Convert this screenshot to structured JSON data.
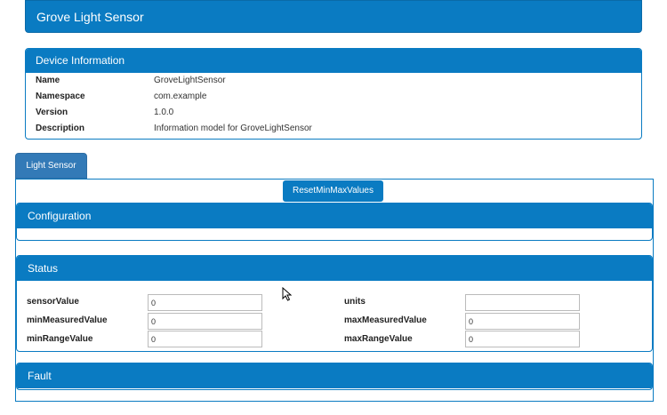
{
  "app": {
    "title": "Grove Light Sensor"
  },
  "device_info": {
    "heading": "Device Information",
    "rows": [
      {
        "key": "Name",
        "value": "GroveLightSensor"
      },
      {
        "key": "Namespace",
        "value": "com.example"
      },
      {
        "key": "Version",
        "value": "1.0.0"
      },
      {
        "key": "Description",
        "value": "Information model for GroveLightSensor"
      }
    ]
  },
  "tabs": [
    {
      "label": "Light Sensor"
    }
  ],
  "actions": {
    "reset_label": "ResetMinMaxValues"
  },
  "sections": {
    "configuration": "Configuration",
    "status": "Status",
    "fault": "Fault"
  },
  "status_fields": {
    "sensorValue": {
      "label": "sensorValue",
      "value": "0"
    },
    "units": {
      "label": "units",
      "value": ""
    },
    "minMeasuredValue": {
      "label": "minMeasuredValue",
      "value": "0"
    },
    "maxMeasuredValue": {
      "label": "maxMeasuredValue",
      "value": "0"
    },
    "minRangeValue": {
      "label": "minRangeValue",
      "value": "0"
    },
    "maxRangeValue": {
      "label": "maxRangeValue",
      "value": "0"
    }
  },
  "colors": {
    "primary": "#0a7bc2",
    "tab": "#337ab7"
  }
}
